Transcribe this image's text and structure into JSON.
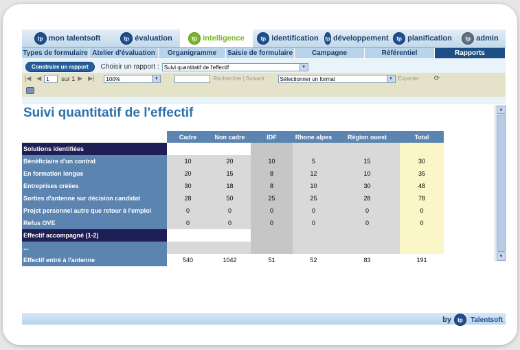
{
  "modules": [
    {
      "label": "mon talentsoft",
      "logo": "tp-logo-icon",
      "active": false
    },
    {
      "label": "évaluation",
      "logo": "tp-logo-icon",
      "active": false
    },
    {
      "label": "intelligence",
      "logo": "tp-logo-icon",
      "active": true
    },
    {
      "label": "identification",
      "logo": "tp-logo-icon",
      "active": false
    },
    {
      "label": "développement",
      "logo": "tp-logo-icon",
      "active": false
    },
    {
      "label": "planification",
      "logo": "tp-logo-icon",
      "active": false
    },
    {
      "label": "admin",
      "logo": "tp-logo-icon",
      "active": false
    }
  ],
  "subnav": [
    {
      "label": "Types de formulaire",
      "active": false
    },
    {
      "label": "Atelier d'évaluation",
      "active": false
    },
    {
      "label": "Organigramme",
      "active": false
    },
    {
      "label": "Saisie de formulaire",
      "active": false
    },
    {
      "label": "Campagne",
      "active": false
    },
    {
      "label": "Référentiel",
      "active": false
    },
    {
      "label": "Rapports",
      "active": true
    }
  ],
  "toolbar": {
    "build_button": "Construire un rapport",
    "choose_label": "Choisir un rapport :",
    "report_select": "Suivi quantitatif de l'effectif",
    "page_value": "1",
    "page_of": "sur 1",
    "zoom": "100%",
    "search_placeholder": "",
    "search_label": "Rechercher",
    "next_label": "Suivant",
    "separator": "|",
    "format_select": "Sélectionner un format",
    "export_label": "Exporter"
  },
  "report": {
    "title": "Suivi quantitatif de l'effectif",
    "columns": [
      "Cadre",
      "Non cadre",
      "IDF",
      "Rhone alpes",
      "Région ouest",
      "Total"
    ],
    "rows": [
      {
        "label": "Solutions identifiées",
        "type": "section",
        "values": [
          "",
          "",
          "",
          "",
          "",
          ""
        ]
      },
      {
        "label": "Bénéficiaire d'un contrat",
        "type": "data",
        "values": [
          "10",
          "20",
          "10",
          "5",
          "15",
          "30"
        ]
      },
      {
        "label": "En formation longue",
        "type": "data",
        "values": [
          "20",
          "15",
          "8",
          "12",
          "10",
          "35"
        ]
      },
      {
        "label": "Entreprises créées",
        "type": "data",
        "values": [
          "30",
          "18",
          "8",
          "10",
          "30",
          "48"
        ]
      },
      {
        "label": "Sorties d'antenne sur décision candidat",
        "type": "data",
        "values": [
          "28",
          "50",
          "25",
          "25",
          "28",
          "78"
        ]
      },
      {
        "label": "Projet personnel autre que retour à l'emploi",
        "type": "data",
        "values": [
          "0",
          "0",
          "0",
          "0",
          "0",
          "0"
        ]
      },
      {
        "label": "Refus OVE",
        "type": "data",
        "values": [
          "0",
          "0",
          "0",
          "0",
          "0",
          "0"
        ]
      },
      {
        "label": "Effectif accompagné (1-2)",
        "type": "section",
        "values": [
          "",
          "",
          "",
          "",
          "",
          ""
        ]
      },
      {
        "label": "...",
        "type": "data",
        "values": [
          "",
          "",
          "",
          "",
          "",
          ""
        ]
      },
      {
        "label": "Effectif entré à l'antenne",
        "type": "total",
        "values": [
          "540",
          "1042",
          "51",
          "52",
          "83",
          "191"
        ]
      }
    ]
  },
  "footer": {
    "by": "by",
    "brand": "Talentsoft"
  },
  "colors": {
    "accent": "#2b71ae",
    "nav_active": "#1d4f86",
    "section_row": "#1f1f55",
    "total_col": "#fbf6c8",
    "module_active": "#7ab829"
  }
}
